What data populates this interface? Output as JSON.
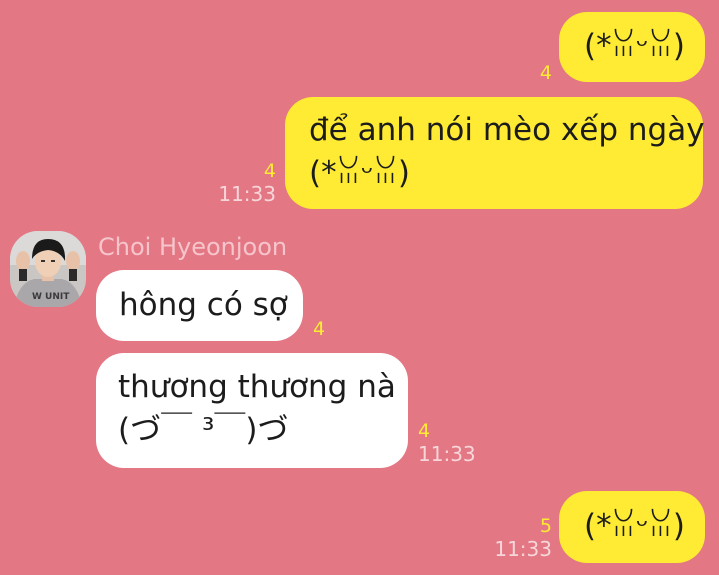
{
  "messages": [
    {
      "text": "(*ꈍᵕꈍ)",
      "unread": "4",
      "time": ""
    },
    {
      "line1": "để anh nói mèo xếp ngày",
      "line2": "(*ꈍᵕꈍ)",
      "unread": "4",
      "time": "11:33"
    },
    {
      "sender": "Choi Hyeonjoon",
      "text": "hông có sợ",
      "unread": "4"
    },
    {
      "line1": "thương thương nà",
      "line2": "(づ￣ ³￣)づ",
      "unread": "4",
      "time": "11:33"
    },
    {
      "text": "(*ꈍᵕꈍ)",
      "unread": "5",
      "time": "11:33"
    }
  ],
  "colors": {
    "background": "#e37784",
    "outgoing_bubble": "#ffeb33",
    "incoming_bubble": "#ffffff",
    "unread_count": "#ffeb33"
  },
  "avatar": {
    "icon": "profile-photo"
  }
}
